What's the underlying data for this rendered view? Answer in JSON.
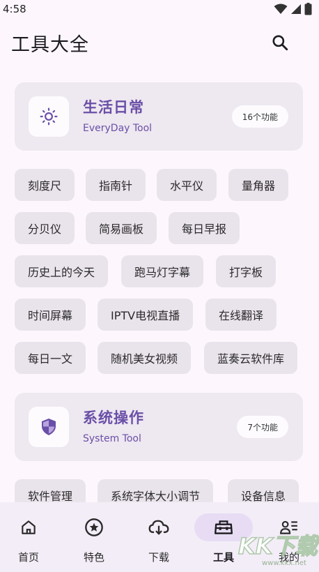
{
  "status_bar": {
    "time": "4:58"
  },
  "app_bar": {
    "title": "工具大全"
  },
  "categories": [
    {
      "title": "生活日常",
      "subtitle": "EveryDay Tool",
      "count": "16个功能",
      "icon": "sun-icon",
      "tools": [
        "刻度尺",
        "指南针",
        "水平仪",
        "量角器",
        "分贝仪",
        "简易画板",
        "每日早报",
        "历史上的今天",
        "跑马灯字幕",
        "打字板",
        "时间屏幕",
        "IPTV电视直播",
        "在线翻译",
        "每日一文",
        "随机美女视频",
        "蓝奏云软件库"
      ]
    },
    {
      "title": "系统操作",
      "subtitle": "System Tool",
      "count": "7个功能",
      "icon": "shield-icon",
      "tools": [
        "软件管理",
        "系统字体大小调节",
        "设备信息"
      ]
    }
  ],
  "bottom_nav": [
    {
      "label": "首页",
      "icon": "home-icon"
    },
    {
      "label": "特色",
      "icon": "star-circle-icon"
    },
    {
      "label": "下载",
      "icon": "cloud-download-icon"
    },
    {
      "label": "工具",
      "icon": "toolbox-icon",
      "active": true
    },
    {
      "label": "我的",
      "icon": "profile-icon"
    }
  ],
  "watermark": "KK下载",
  "colors": {
    "accent": "#6a4fa8",
    "card_bg": "#eee8f0",
    "chip_bg": "#e9e3ec",
    "nav_bg": "#f3edf7",
    "nav_active": "#e7dcf4"
  }
}
